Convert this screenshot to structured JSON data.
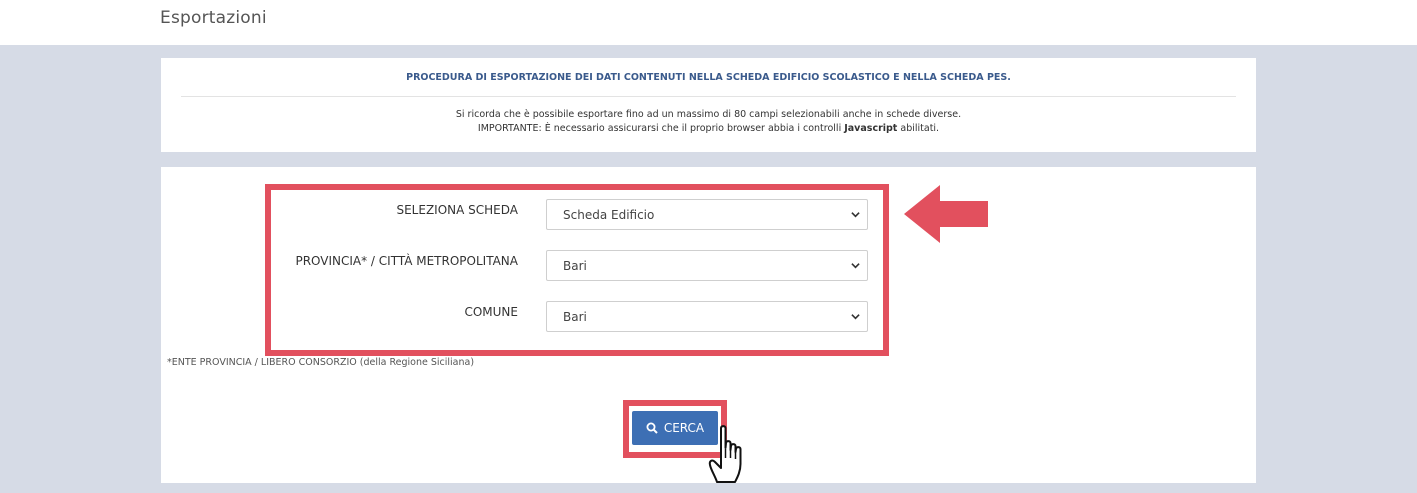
{
  "header": {
    "title": "Esportazioni"
  },
  "info": {
    "heading": "PROCEDURA DI ESPORTAZIONE DEI DATI CONTENUTI NELLA SCHEDA EDIFICIO SCOLASTICO E NELLA SCHEDA PES.",
    "line1": "Si ricorda che è possibile esportare fino ad un massimo di 80 campi selezionabili anche in schede diverse.",
    "line2_prefix": "IMPORTANTE: È necessario assicurarsi che il proprio browser abbia i controlli ",
    "line2_bold": "Javascript",
    "line2_suffix": " abilitati."
  },
  "form": {
    "scheda": {
      "label": "SELEZIONA SCHEDA",
      "value": "Scheda Edificio"
    },
    "provincia": {
      "label": "PROVINCIA* / CITTÀ METROPOLITANA",
      "value": "Bari"
    },
    "comune": {
      "label": "COMUNE",
      "value": "Bari"
    },
    "footnote": "*ENTE PROVINCIA / LIBERO CONSORZIO (della Regione Siciliana)",
    "search_label": "CERCA"
  },
  "colors": {
    "highlight": "#e2505e",
    "button": "#3d6fb4",
    "background": "#d6dbe6"
  },
  "icons": {
    "search": "search-icon",
    "chevron": "chevron-down-icon",
    "arrow": "arrow-left-icon",
    "cursor": "hand-pointer-icon"
  }
}
